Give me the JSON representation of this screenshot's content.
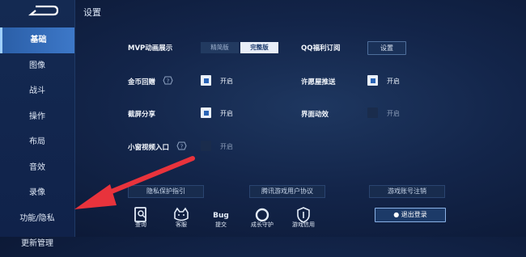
{
  "sidebar": {
    "items": [
      {
        "label": "基础",
        "active": true
      },
      {
        "label": "图像"
      },
      {
        "label": "战斗"
      },
      {
        "label": "操作"
      },
      {
        "label": "布局"
      },
      {
        "label": "音效"
      },
      {
        "label": "录像"
      },
      {
        "label": "功能/隐私"
      },
      {
        "label": "更新管理"
      }
    ]
  },
  "page_title": "设置",
  "settings": {
    "mvp": {
      "label": "MVP动画展示",
      "options": [
        "精简版",
        "完整版"
      ],
      "selected": "完整版"
    },
    "qq": {
      "label": "QQ福利订阅",
      "button": "设置"
    },
    "coin": {
      "label": "金币回赠",
      "state": "开启",
      "checked": true
    },
    "wish": {
      "label": "许愿屋推送",
      "state": "开启",
      "checked": true
    },
    "screenshot": {
      "label": "截屏分享",
      "state": "开启",
      "checked": true
    },
    "anim": {
      "label": "界面动效",
      "state": "开启",
      "checked": false
    },
    "miniwin": {
      "label": "小窗视频入口",
      "state": "开启",
      "checked": false
    }
  },
  "links": [
    "隐私保护指引",
    "腾讯游戏用户协议",
    "游戏账号注销"
  ],
  "bottom_icons": [
    {
      "label": "查询",
      "icon": "query-icon"
    },
    {
      "label": "客服",
      "icon": "customer-service-icon"
    },
    {
      "label": "提交",
      "icon": "bug-icon",
      "glyph": "Bug"
    },
    {
      "label": "成长守护",
      "icon": "growth-guard-icon"
    },
    {
      "label": "游戏信用",
      "icon": "credit-shield-icon"
    }
  ],
  "logout": {
    "label": "退出登录",
    "icon": "user-icon"
  },
  "colors": {
    "accent": "#3d78c8",
    "annotation_arrow": "#e8333c",
    "background": "#13254a"
  }
}
